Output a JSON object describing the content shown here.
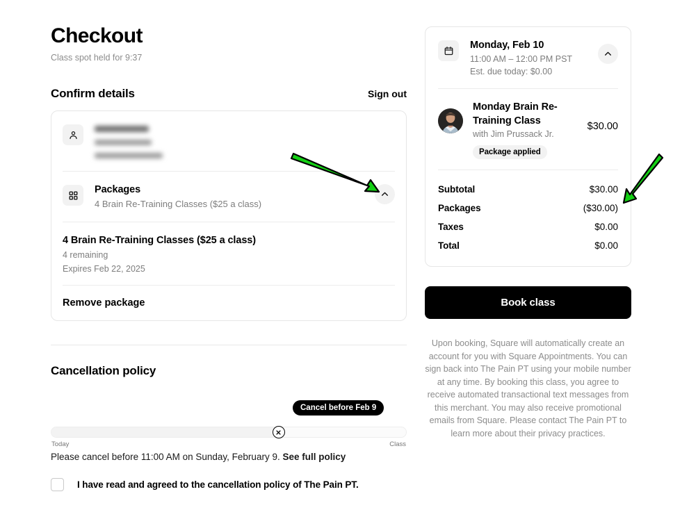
{
  "header": {
    "title": "Checkout",
    "subtitle": "Class spot held for 9:37"
  },
  "confirm": {
    "section_title": "Confirm details",
    "sign_out": "Sign out",
    "customer": {
      "redacted": true,
      "name": "",
      "phone": "",
      "email": ""
    },
    "packages_row": {
      "title": "Packages",
      "subtitle": "4 Brain Re-Training Classes ($25 a class)",
      "collapse_icon": "chevron-up-icon"
    },
    "package_detail": {
      "title": "4 Brain Re-Training Classes ($25 a class)",
      "remaining": "4 remaining",
      "expires": "Expires Feb 22, 2025"
    },
    "remove_package": "Remove package"
  },
  "cancellation": {
    "title": "Cancellation policy",
    "tooltip": "Cancel before Feb 9",
    "timeline_start": "Today",
    "timeline_end": "Class",
    "timeline_marker_percent": 64,
    "policy_text": "Please cancel before 11:00 AM on Sunday, February 9.",
    "policy_link": "See full policy",
    "agree_label": "I have read and agreed to the cancellation policy of The Pain PT.",
    "agree_checked": false
  },
  "summary": {
    "date": "Monday, Feb 10",
    "time": "11:00 AM – 12:00 PM PST",
    "due_today": "Est. due today: $0.00",
    "collapse_icon": "chevron-up-icon",
    "item": {
      "title": "Monday Brain Re-Training Class",
      "staff": "with Jim Prussack Jr.",
      "badge": "Package applied",
      "price": "$30.00"
    },
    "totals": [
      {
        "label": "Subtotal",
        "value": "$30.00"
      },
      {
        "label": "Packages",
        "value": "($30.00)"
      },
      {
        "label": "Taxes",
        "value": "$0.00"
      },
      {
        "label": "Total",
        "value": "$0.00"
      }
    ],
    "book_button": "Book class",
    "disclaimer": "Upon booking, Square will automatically create an account for you with Square Appointments. You can sign back into The Pain PT using your mobile number at any time. By booking this class, you agree to receive automated transactional text messages from this merchant. You may also receive promotional emails from Square. Please contact The Pain PT to learn more about their privacy practices."
  },
  "annotations": {
    "arrow_color": "#14D014",
    "arrow_outline": "#000000",
    "arrows": [
      {
        "name": "arrow-to-packages-collapse",
        "points": "from (420,229) to (545,273)"
      },
      {
        "name": "arrow-to-packages-discount",
        "points": "from (952,228) to (898,292)"
      }
    ]
  }
}
